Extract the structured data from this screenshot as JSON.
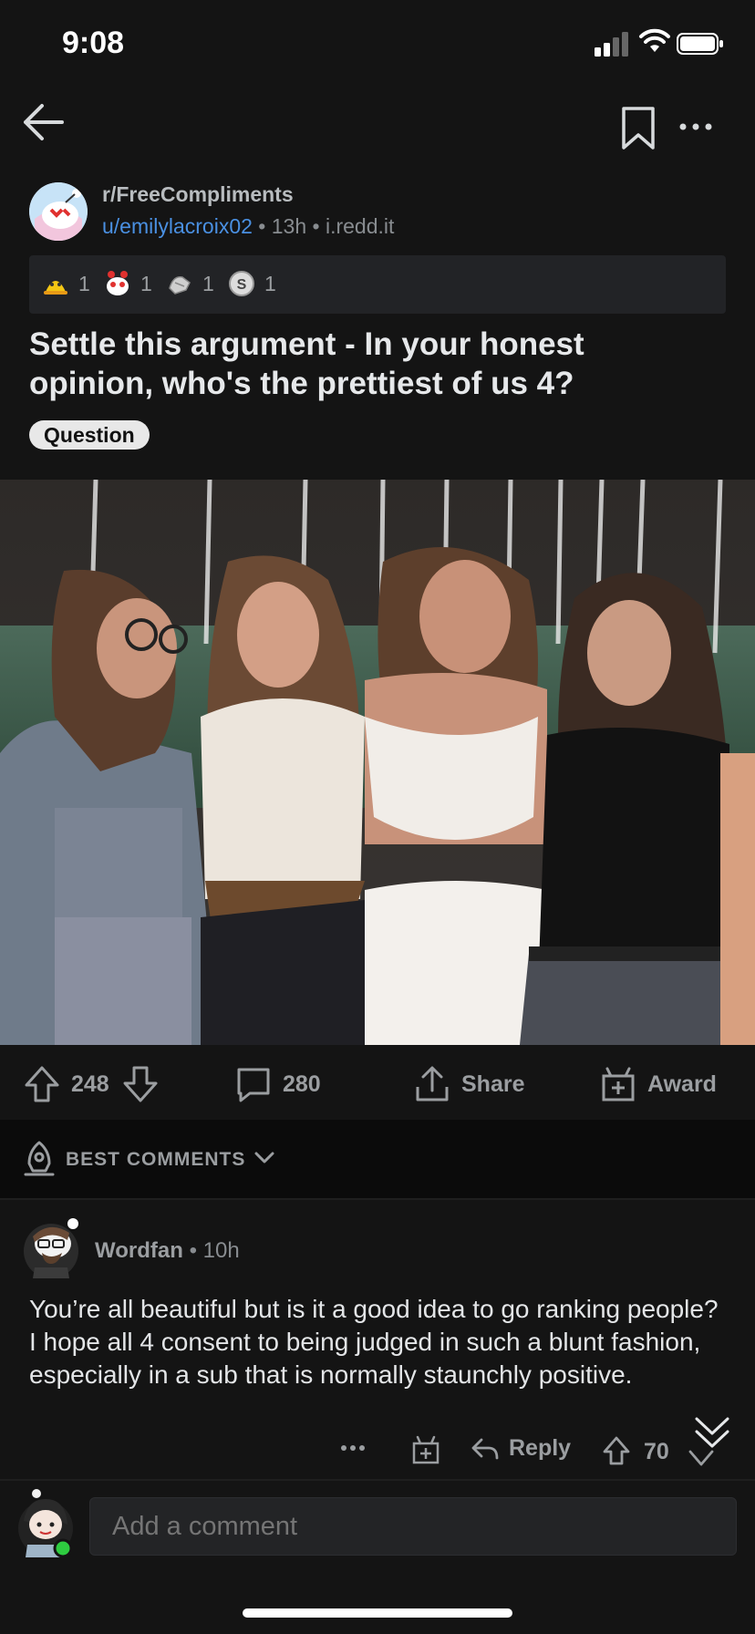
{
  "status_bar": {
    "time": "9:08"
  },
  "post": {
    "subreddit": "r/FreeCompliments",
    "author": "u/emilylacroix02",
    "sep1": "•",
    "age": "13h",
    "sep2": "•",
    "domain": "i.redd.it",
    "awards": [
      {
        "icon": "helpful-award-icon",
        "count": "1"
      },
      {
        "icon": "wholesome-award-icon",
        "count": "1"
      },
      {
        "icon": "hugz-award-icon",
        "count": "1"
      },
      {
        "icon": "silver-award-icon",
        "count": "1"
      }
    ],
    "title": "Settle this argument - In your honest opinion, who's the prettiest of us 4?",
    "flair": "Question"
  },
  "actions": {
    "votes": "248",
    "comments": "280",
    "share_label": "Share",
    "award_label": "Award"
  },
  "sort": {
    "label": "BEST COMMENTS"
  },
  "comment": {
    "user": "Wordfan",
    "sep": "•",
    "age": "10h",
    "body": "You’re all beautiful but is it a good idea to go ranking people?  I hope all 4 consent to being judged in such a blunt fashion, especially in a sub that is normally staunchly positive.",
    "reply_label": "Reply",
    "votes": "70"
  },
  "composer": {
    "placeholder": "Add a comment"
  },
  "colors": {
    "background": "#141414",
    "link": "#4a90e2",
    "muted": "#9b9ea1",
    "online": "#2ecc40"
  }
}
